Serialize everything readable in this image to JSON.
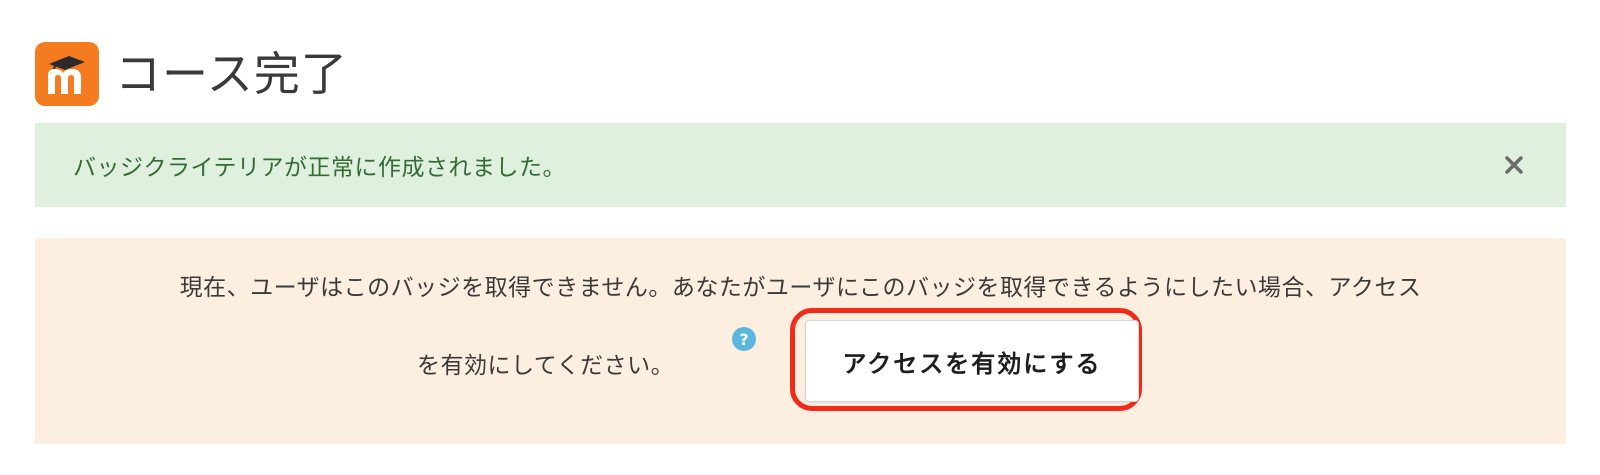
{
  "header": {
    "logo_icon": "moodle-logo-icon",
    "title": "コース完了"
  },
  "success_alert": {
    "message": "バッジクライテリアが正常に作成されました。",
    "close_icon": "close-icon"
  },
  "warning_alert": {
    "message_line1": "現在、ユーザはこのバッジを取得できません。あなたがユーザにこのバッジを取得できるようにしたい場合、アクセス",
    "message_line2": "を有効にしてください。",
    "help_icon": "help-icon",
    "enable_button_label": "アクセスを有効にする"
  },
  "colors": {
    "brand_orange": "#f47b20",
    "success_bg": "#dff0de",
    "success_text": "#356b35",
    "warning_bg": "#fcefe0",
    "help_blue": "#5bb7de",
    "highlight_red": "#f22a1a"
  }
}
